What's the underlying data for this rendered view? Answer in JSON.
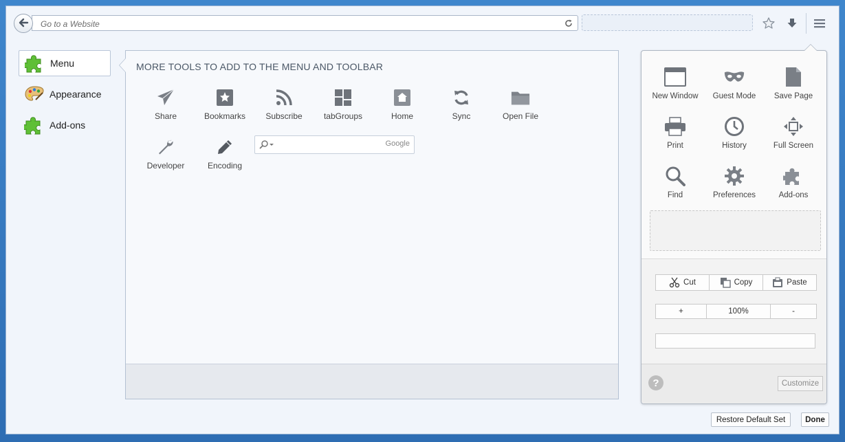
{
  "toolbar": {
    "url_placeholder": "Go to a Website",
    "icons": [
      "back-arrow-icon",
      "reload-icon",
      "bookmark-star-icon",
      "downloads-icon",
      "menu-hamburger-icon"
    ]
  },
  "categories": [
    {
      "label": "Menu",
      "icon": "puzzle-icon",
      "active": true
    },
    {
      "label": "Appearance",
      "icon": "palette-icon",
      "active": false
    },
    {
      "label": "Add-ons",
      "icon": "puzzle-icon",
      "active": false
    }
  ],
  "palette": {
    "title": "MORE TOOLS TO ADD TO THE MENU AND TOOLBAR",
    "tools": [
      {
        "label": "Share",
        "icon": "paper-plane-icon"
      },
      {
        "label": "Bookmarks",
        "icon": "bookmarks-star-icon"
      },
      {
        "label": "Subscribe",
        "icon": "rss-icon"
      },
      {
        "label": "tabGroups",
        "icon": "tab-groups-icon"
      },
      {
        "label": "Home",
        "icon": "home-icon"
      },
      {
        "label": "Sync",
        "icon": "sync-icon"
      },
      {
        "label": "Open File",
        "icon": "folder-icon"
      },
      {
        "label": "Developer",
        "icon": "wrench-icon"
      },
      {
        "label": "Encoding",
        "icon": "pencil-icon"
      }
    ],
    "search_engine": "Google"
  },
  "panel": {
    "items": [
      {
        "label": "New Window",
        "icon": "new-window-icon"
      },
      {
        "label": "Guest Mode",
        "icon": "mask-icon"
      },
      {
        "label": "Save Page",
        "icon": "save-page-icon"
      },
      {
        "label": "Print",
        "icon": "printer-icon"
      },
      {
        "label": "History",
        "icon": "clock-icon"
      },
      {
        "label": "Full Screen",
        "icon": "fullscreen-icon"
      },
      {
        "label": "Find",
        "icon": "magnifier-icon"
      },
      {
        "label": "Preferences",
        "icon": "gear-icon"
      },
      {
        "label": "Add-ons",
        "icon": "puzzle-icon"
      }
    ],
    "edit": {
      "cut": "Cut",
      "copy": "Copy",
      "paste": "Paste"
    },
    "zoom": {
      "plus": "+",
      "level": "100%",
      "minus": "-"
    },
    "help": "?",
    "customize": "Customize"
  },
  "footer": {
    "restore": "Restore Default Set",
    "done": "Done"
  }
}
